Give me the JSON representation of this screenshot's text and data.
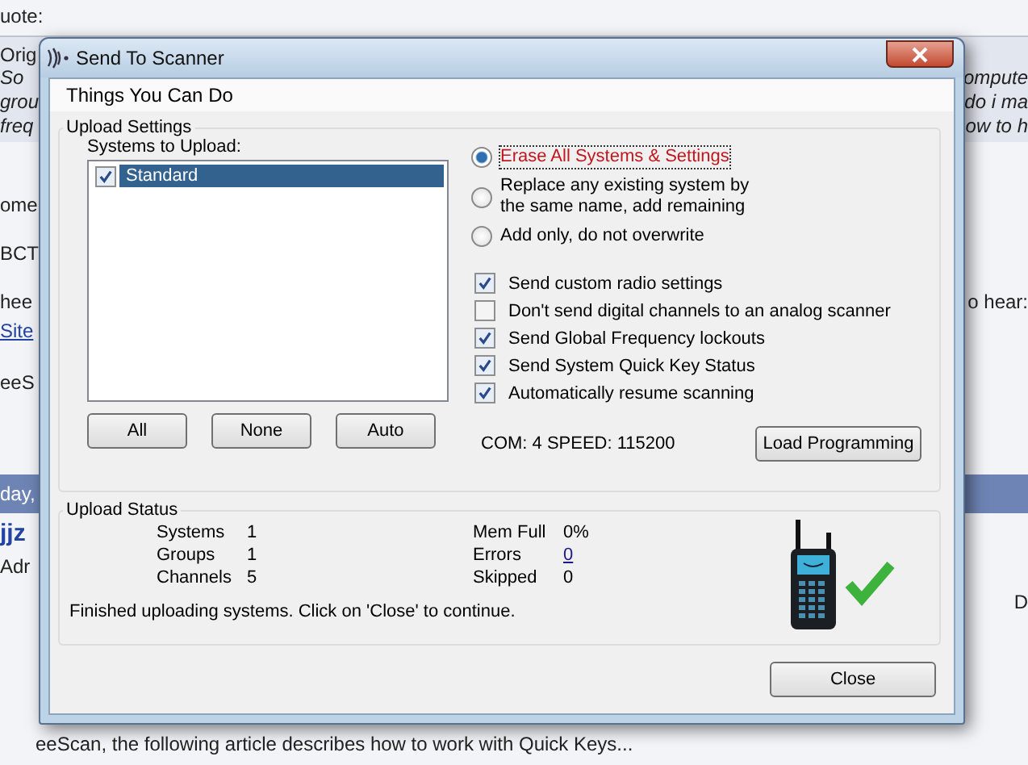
{
  "background_page": {
    "fragments": [
      {
        "text": "uote:",
        "kind": "plain"
      },
      {
        "text": "Orig",
        "kind": "plain"
      },
      {
        "text": "So",
        "kind": "italic"
      },
      {
        "text": "grou",
        "kind": "italic"
      },
      {
        "text": "freq",
        "kind": "italic"
      },
      {
        "text": "ompute",
        "kind": "italic"
      },
      {
        "text": "do i ma",
        "kind": "italic"
      },
      {
        "text": "ow to h",
        "kind": "italic"
      },
      {
        "text": "ome",
        "kind": "plain"
      },
      {
        "text": "BCT",
        "kind": "plain"
      },
      {
        "text": "hee",
        "kind": "plain"
      },
      {
        "text": "Site",
        "kind": "link"
      },
      {
        "text": "o hear:",
        "kind": "plain"
      },
      {
        "text": "eeS",
        "kind": "plain"
      },
      {
        "text": "day,",
        "kind": "band"
      },
      {
        "text": "jjz",
        "kind": "name"
      },
      {
        "text": "Adr",
        "kind": "plain"
      },
      {
        "text": "D",
        "kind": "plain"
      },
      {
        "text": "eeScan, the following article describes how to work with Quick Keys...",
        "kind": "plain"
      }
    ]
  },
  "window": {
    "title": "Send To Scanner"
  },
  "menu": [
    "Things You Can Do"
  ],
  "upload_settings": {
    "title": "Upload Settings",
    "list_label": "Systems to Upload:",
    "systems": [
      {
        "label": "Standard",
        "checked": true,
        "selected": true
      }
    ],
    "list_buttons": [
      "All",
      "None",
      "Auto"
    ],
    "radios": [
      {
        "label": "Erase All Systems & Settings",
        "selected": true
      },
      {
        "label": "Replace any existing system by the same name, add remaining",
        "selected": false
      },
      {
        "label": "Add only, do not overwrite",
        "selected": false
      }
    ],
    "checkboxes": [
      {
        "label": "Send custom radio settings",
        "checked": true
      },
      {
        "label": "Don't send digital channels to an analog scanner",
        "checked": false
      },
      {
        "label": "Send Global Frequency lockouts",
        "checked": true
      },
      {
        "label": "Send System Quick Key Status",
        "checked": true
      },
      {
        "label": "Automatically resume scanning",
        "checked": true
      }
    ],
    "port_info": "COM: 4 SPEED: 115200",
    "load_button": "Load Programming"
  },
  "upload_status": {
    "title": "Upload Status",
    "stats_left": [
      {
        "label": "Systems",
        "value": "1"
      },
      {
        "label": "Groups",
        "value": "1"
      },
      {
        "label": "Channels",
        "value": "5"
      }
    ],
    "stats_right": [
      {
        "label": "Mem Full",
        "value": "0%"
      },
      {
        "label": "Errors",
        "value": "0",
        "link": true
      },
      {
        "label": "Skipped",
        "value": "0"
      }
    ],
    "message": "Finished uploading systems. Click on 'Close' to continue."
  },
  "close_button": "Close"
}
